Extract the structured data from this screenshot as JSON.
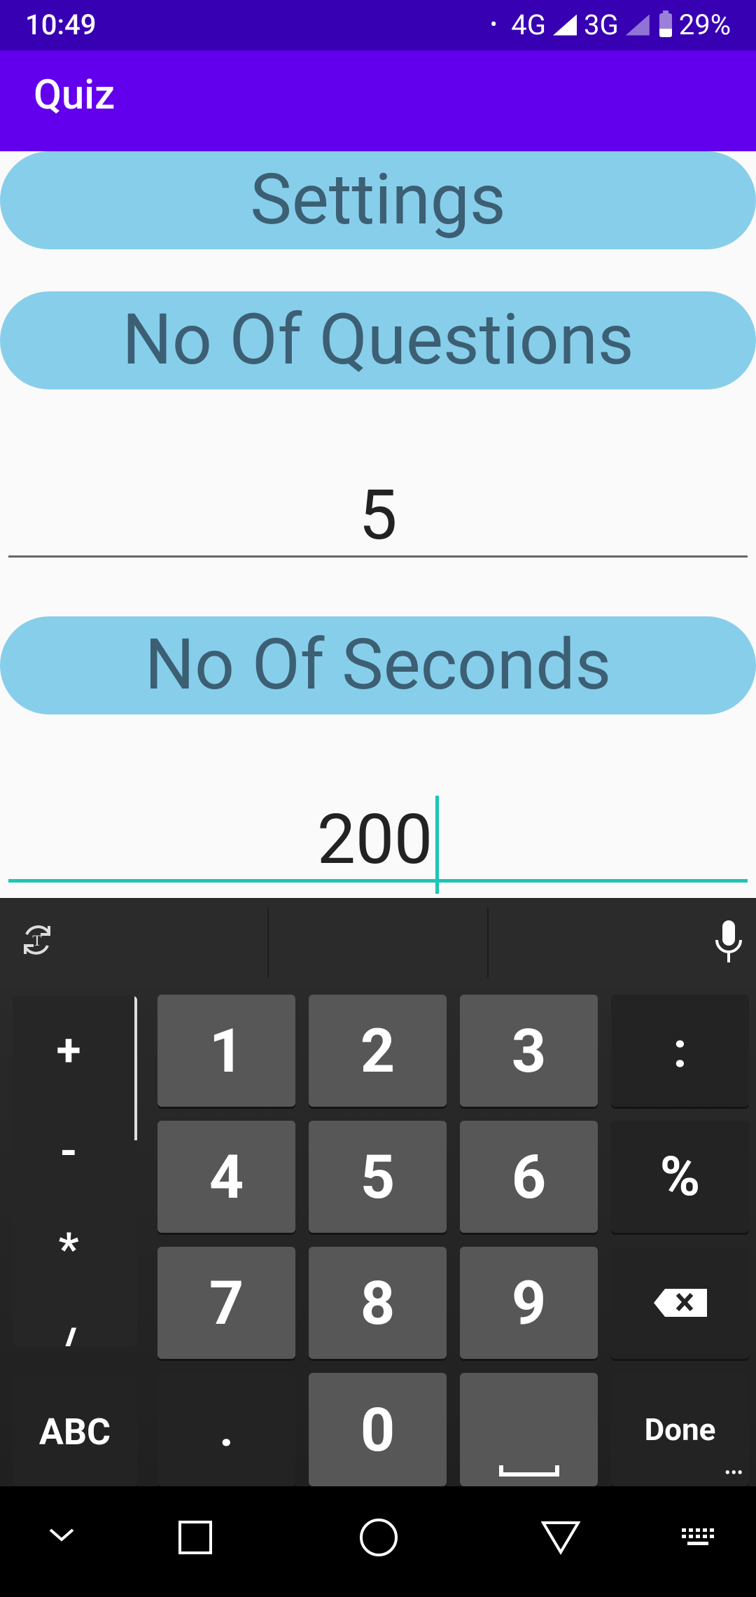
{
  "status_bar": {
    "time": "10:49",
    "dot": "•",
    "network1": "4G",
    "network2": "3G",
    "battery": "29%"
  },
  "app_bar": {
    "title": "Quiz"
  },
  "settings": {
    "header_label": "Settings",
    "questions_label": "No Of Questions",
    "questions_value": "5",
    "seconds_label": "No Of Seconds",
    "seconds_value": "200"
  },
  "keyboard": {
    "operators": [
      "+",
      "-",
      "*",
      "/"
    ],
    "keys": {
      "k1": "1",
      "k2": "2",
      "k3": "3",
      "colon": ":",
      "k4": "4",
      "k5": "5",
      "k6": "6",
      "percent": "%",
      "k7": "7",
      "k8": "8",
      "k9": "9",
      "abc": "ABC",
      "dot": ".",
      "k0": "0",
      "done": "Done"
    }
  },
  "icons": {
    "translate": "translate-icon",
    "mic": "microphone-icon",
    "backspace": "backspace-icon",
    "space": "space-icon",
    "back": "nav-back-icon",
    "recents": "nav-recents-icon",
    "home": "nav-home-icon",
    "triangle": "nav-triangle-icon",
    "keyboard": "keyboard-switch-icon"
  },
  "colors": {
    "status_bar": "#3700b3",
    "app_bar": "#6200ee",
    "pill": "#87ceeb",
    "pill_text": "#3c5f73",
    "focus": "#1cc6b6"
  }
}
